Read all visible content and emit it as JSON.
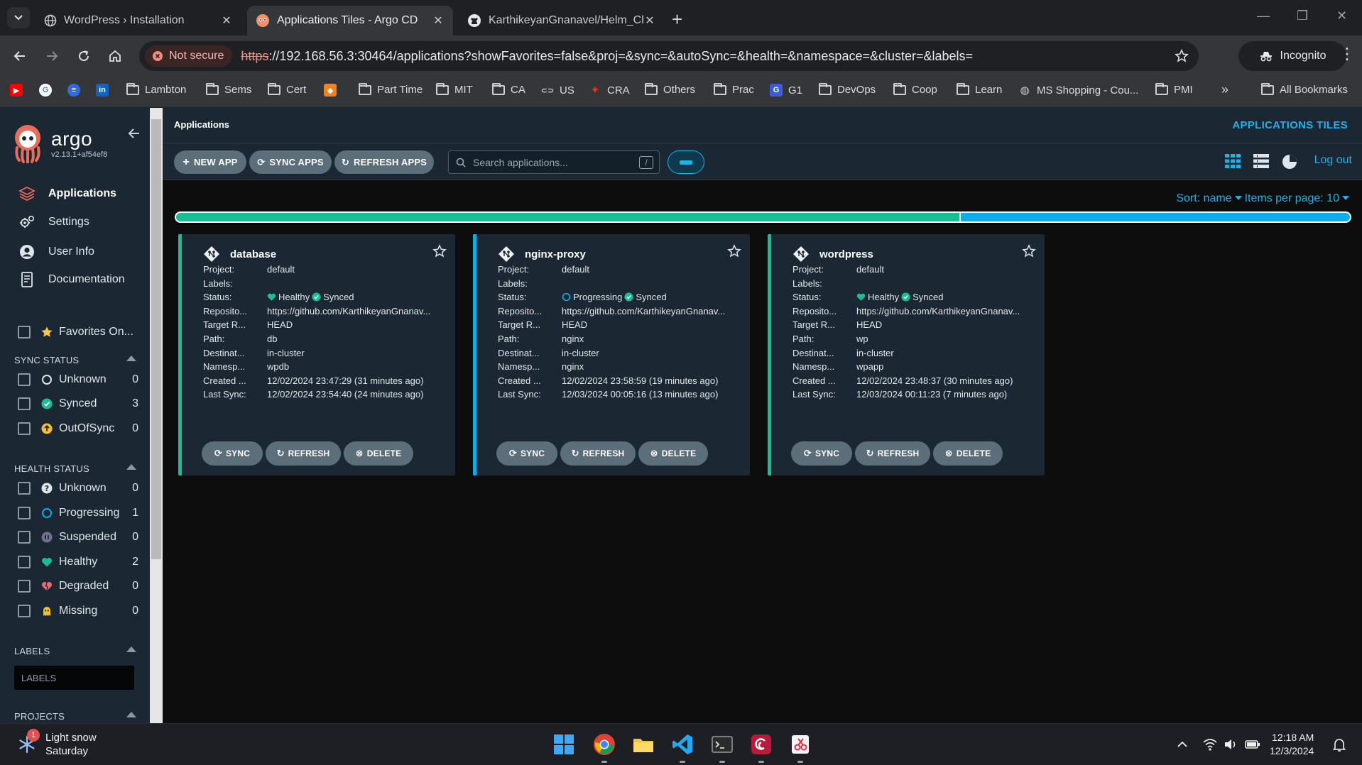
{
  "browser": {
    "tabs": [
      {
        "title": "WordPress › Installation",
        "active": false
      },
      {
        "title": "Applications Tiles - Argo CD",
        "active": true
      },
      {
        "title": "KarthikeyanGnanavel/Helm_Cha",
        "active": false
      }
    ],
    "security_label": "Not secure",
    "url_scheme": "https",
    "url_rest": "://192.168.56.3:30464/applications?showFavorites=false&proj=&sync=&autoSync=&health=&namespace=&cluster=&labels=",
    "incognito_label": "Incognito",
    "bookmarks": [
      "Lambton",
      "Sems",
      "Cert",
      "Part Time",
      "MIT",
      "CA",
      "US",
      "CRA",
      "Others",
      "Prac",
      "G1",
      "DevOps",
      "Coop",
      "Learn",
      "MS Shopping - Cou...",
      "PMI"
    ],
    "all_bookmarks": "All Bookmarks"
  },
  "sidebar": {
    "brand": "argo",
    "version": "v2.13.1+af54ef8",
    "nav": [
      {
        "label": "Applications",
        "icon": "layers-icon"
      },
      {
        "label": "Settings",
        "icon": "gears-icon"
      },
      {
        "label": "User Info",
        "icon": "user-circle-icon"
      },
      {
        "label": "Documentation",
        "icon": "book-icon"
      }
    ],
    "favorites_label": "Favorites On...",
    "sync_status": {
      "title": "SYNC STATUS",
      "items": [
        {
          "label": "Unknown",
          "count": "0"
        },
        {
          "label": "Synced",
          "count": "3"
        },
        {
          "label": "OutOfSync",
          "count": "0"
        }
      ]
    },
    "health_status": {
      "title": "HEALTH STATUS",
      "items": [
        {
          "label": "Unknown",
          "count": "0"
        },
        {
          "label": "Progressing",
          "count": "1"
        },
        {
          "label": "Suspended",
          "count": "0"
        },
        {
          "label": "Healthy",
          "count": "2"
        },
        {
          "label": "Degraded",
          "count": "0"
        },
        {
          "label": "Missing",
          "count": "0"
        }
      ]
    },
    "labels": {
      "title": "LABELS",
      "placeholder": "LABELS"
    },
    "projects": {
      "title": "PROJECTS"
    }
  },
  "main": {
    "breadcrumb": "Applications",
    "page_title": "APPLICATIONS TILES",
    "toolbar": {
      "new_app": "NEW APP",
      "sync_apps": "SYNC APPS",
      "refresh_apps": "REFRESH APPS",
      "search_placeholder": "Search applications...",
      "search_shortcut": "/",
      "logout": "Log out"
    },
    "sort": {
      "label": "Sort: name",
      "items_per_page": "Items per page: 10"
    },
    "status_bar": {
      "healthy_fraction": 0.667,
      "progressing_fraction": 0.333,
      "healthy_color": "#18be94",
      "progressing_color": "#0dadea"
    },
    "field_labels": {
      "project": "Project:",
      "labels": "Labels:",
      "status": "Status:",
      "repository": "Reposito...",
      "target": "Target R...",
      "path": "Path:",
      "destination": "Destinat...",
      "namespace": "Namesp...",
      "created": "Created ...",
      "last_sync": "Last Sync:"
    },
    "card_buttons": {
      "sync": "SYNC",
      "refresh": "REFRESH",
      "delete": "DELETE"
    },
    "apps": [
      {
        "name": "database",
        "project": "default",
        "labels": "",
        "health": "Healthy",
        "sync": "Synced",
        "repo": "https://github.com/KarthikeyanGnanav...",
        "target": "HEAD",
        "path": "db",
        "destination": "in-cluster",
        "namespace": "wpdb",
        "created": "12/02/2024 23:47:29  (31 minutes ago)",
        "last_sync": "12/02/2024 23:54:40  (24 minutes ago)",
        "accent": "#18be94"
      },
      {
        "name": "nginx-proxy",
        "project": "default",
        "labels": "",
        "health": "Progressing",
        "sync": "Synced",
        "repo": "https://github.com/KarthikeyanGnanav...",
        "target": "HEAD",
        "path": "nginx",
        "destination": "in-cluster",
        "namespace": "nginx",
        "created": "12/02/2024 23:58:59  (19 minutes ago)",
        "last_sync": "12/03/2024 00:05:16  (13 minutes ago)",
        "accent": "#0dadea"
      },
      {
        "name": "wordpress",
        "project": "default",
        "labels": "",
        "health": "Healthy",
        "sync": "Synced",
        "repo": "https://github.com/KarthikeyanGnanav...",
        "target": "HEAD",
        "path": "wp",
        "destination": "in-cluster",
        "namespace": "wpapp",
        "created": "12/02/2024 23:48:37  (30 minutes ago)",
        "last_sync": "12/03/2024 00:11:23  (7 minutes ago)",
        "accent": "#18be94"
      }
    ]
  },
  "taskbar": {
    "weather_line1": "Light snow",
    "weather_line2": "Saturday",
    "weather_badge": "1",
    "time": "12:18 AM",
    "date": "12/3/2024"
  }
}
